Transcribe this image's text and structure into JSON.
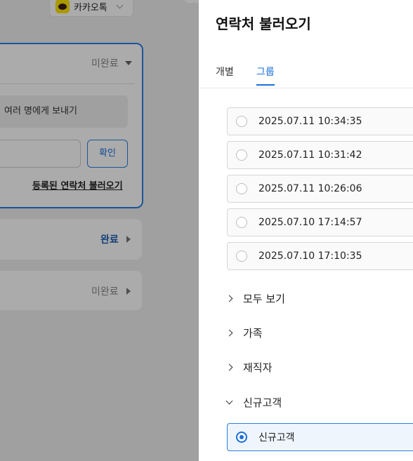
{
  "background": {
    "messenger": {
      "label": "카카오톡"
    },
    "sections": [
      {
        "status": "미완료"
      },
      {
        "status": "완료"
      },
      {
        "status": "미완료"
      }
    ],
    "multi_send_label": "여러 명에게 보내기",
    "confirm_label": "확인",
    "load_contacts_link": "등록된 연락처 불러오기"
  },
  "panel": {
    "title": "연락처 불러오기",
    "tabs": [
      {
        "label": "개별"
      },
      {
        "label": "그룹"
      }
    ],
    "active_tab": "그룹",
    "history": [
      {
        "label": "2025.07.11 10:34:35"
      },
      {
        "label": "2025.07.11 10:31:42"
      },
      {
        "label": "2025.07.11 10:26:06"
      },
      {
        "label": "2025.07.10 17:14:57"
      },
      {
        "label": "2025.07.10 17:10:35"
      }
    ],
    "groups": [
      {
        "label": "모두 보기",
        "expanded": false
      },
      {
        "label": "가족",
        "expanded": false
      },
      {
        "label": "재직자",
        "expanded": false
      },
      {
        "label": "신규고객",
        "expanded": true
      }
    ],
    "group_items": [
      {
        "label": "신규고객",
        "selected": true
      }
    ]
  },
  "colors": {
    "accent": "#1a6fd8",
    "active_border": "#2b7fe0",
    "kakao_yellow": "#fee500"
  }
}
